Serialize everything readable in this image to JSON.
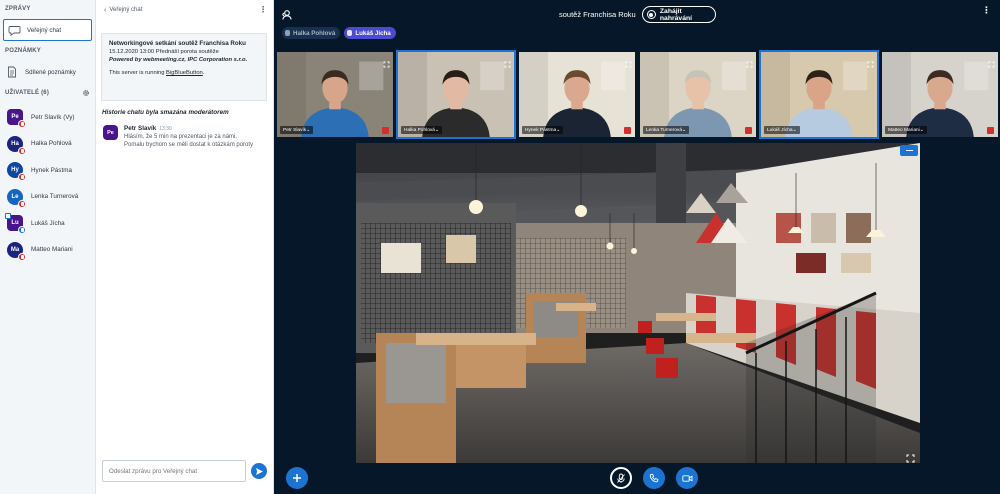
{
  "sidebar": {
    "messages_title": "ZPRÁVY",
    "public_chat": "Veřejný chat",
    "notes_title": "POZNÁMKY",
    "shared_notes": "Sdílené poznámky",
    "users_title": "UŽIVATELÉ (6)",
    "users": [
      {
        "initials": "Pe",
        "name": "Petr Slavík (Vy)",
        "color": "#4a148c",
        "shape": "square",
        "voice": "red",
        "presenter": false
      },
      {
        "initials": "Ha",
        "name": "Halka Pohlová",
        "color": "#1a237e",
        "shape": "circle",
        "voice": "red",
        "presenter": false
      },
      {
        "initials": "Hy",
        "name": "Hynek Pástma",
        "color": "#0d47a1",
        "shape": "circle",
        "voice": "red",
        "presenter": false
      },
      {
        "initials": "Le",
        "name": "Lenka Turnerová",
        "color": "#1565c0",
        "shape": "circle",
        "voice": "red",
        "presenter": false
      },
      {
        "initials": "Lu",
        "name": "Lukáš Jícha",
        "color": "#4a148c",
        "shape": "square",
        "voice": "blue",
        "presenter": true
      },
      {
        "initials": "Ma",
        "name": "Matteo Mariani",
        "color": "#1a237e",
        "shape": "circle",
        "voice": "red",
        "presenter": false
      }
    ]
  },
  "chat": {
    "header": "Veřejný chat",
    "welcome": {
      "line1": "Networkingové setkání soutěž Franchisa Roku",
      "line2": "15.12.2020 13:00 Přednáší porota soutěže",
      "line3": "Powered by webmeeting.cz, IPC Corporation s.r.o.",
      "line4_prefix": "This server is running ",
      "line4_link": "BigBlueButton",
      "line4_suffix": "."
    },
    "cleared_notice": "Historie chatu byla smazána moderátorem",
    "messages": [
      {
        "initials": "Pe",
        "author": "Petr Slavík",
        "time": "13:30",
        "lines": [
          "Hlásím, že 5 min na prezentaci je za námi.",
          "Pomalu bychom se měli dostat k otázkám poroty"
        ]
      }
    ],
    "input_placeholder": "Odeslat zprávu pro Veřejný chat"
  },
  "topbar": {
    "title": "soutěž Franchisa Roku",
    "record_label": "Zahájit nahrávání",
    "talkers": [
      {
        "name": "Halka Pohlová",
        "active": false
      },
      {
        "name": "Lukáš Jícha",
        "active": true
      }
    ]
  },
  "videos": [
    {
      "name": "Petr Slavík",
      "talking": false,
      "muted": true,
      "shirt": "#2d6fb5",
      "skin": "#d6a58a",
      "hair": "#3a2a20",
      "bg": "#8a8478"
    },
    {
      "name": "Halka Pohlová",
      "talking": true,
      "muted": false,
      "shirt": "#2b2b2b",
      "skin": "#e2b9a2",
      "hair": "#2a1d16",
      "bg": "#c9c1b3"
    },
    {
      "name": "Hynek Pástma",
      "talking": false,
      "muted": true,
      "shirt": "#1b2433",
      "skin": "#d9a88e",
      "hair": "#6b4a2e",
      "bg": "#e7e2d6"
    },
    {
      "name": "Lenka Turnerová",
      "talking": false,
      "muted": true,
      "shirt": "#7d97b0",
      "skin": "#e8c2a8",
      "hair": "#c9c2b8",
      "bg": "#dcd4c4"
    },
    {
      "name": "Lukáš Jícha",
      "talking": true,
      "muted": false,
      "shirt": "#b7cbe0",
      "skin": "#d9a488",
      "hair": "#2d2118",
      "bg": "#d7c9ae"
    },
    {
      "name": "Matteo Mariani",
      "talking": false,
      "muted": true,
      "shirt": "#1e2c44",
      "skin": "#d8a88f",
      "hair": "#3b2b21",
      "bg": "#d6d2cc"
    }
  ],
  "icons": {
    "users_toggle": "users-icon",
    "record": "record-icon",
    "action": "plus-icon",
    "mic": "microphone-icon",
    "phone": "phone-icon",
    "camera": "camera-icon",
    "send": "send-icon"
  },
  "colors": {
    "accent": "#1b73d2",
    "dark_bg": "#06172a",
    "talker_active": "#4b4bd0",
    "muted": "#d32f2f"
  }
}
